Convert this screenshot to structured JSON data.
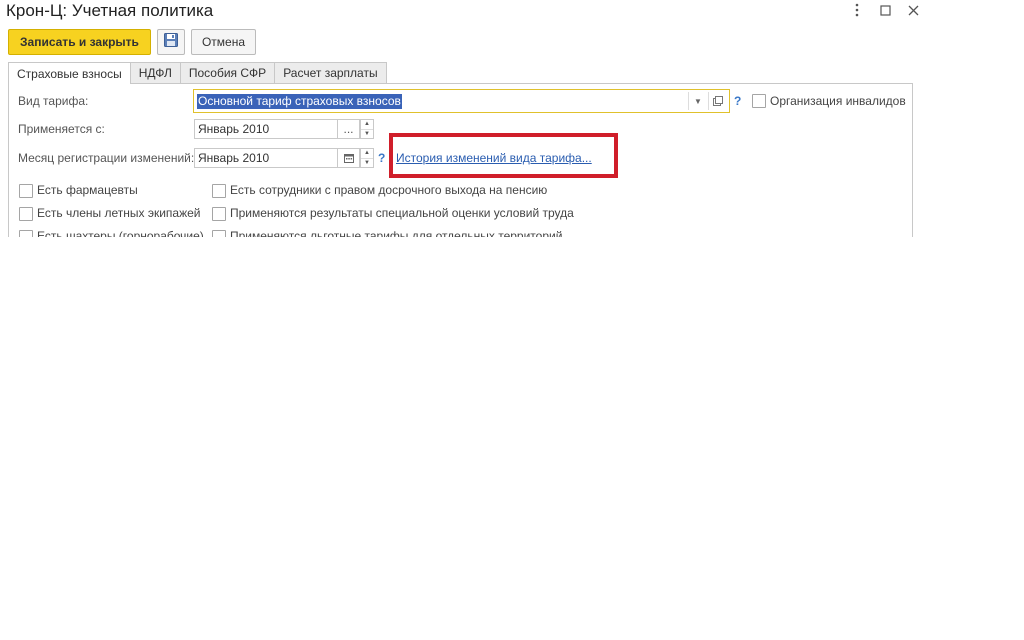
{
  "window": {
    "title": "Крон-Ц: Учетная политика",
    "controls": [
      "more-icon",
      "maximize-icon",
      "close-icon"
    ]
  },
  "toolbar": {
    "save_close_label": "Записать и закрыть",
    "save_icon": "floppy-disk-icon",
    "cancel_label": "Отмена"
  },
  "tabs": [
    {
      "label": "Страховые взносы",
      "active": true
    },
    {
      "label": "НДФЛ",
      "active": false
    },
    {
      "label": "Пособия СФР",
      "active": false
    },
    {
      "label": "Расчет зарплаты",
      "active": false
    }
  ],
  "form": {
    "tariff_label": "Вид тарифа:",
    "tariff_value": "Основной тариф страховых взносов",
    "help_mark": "?",
    "invalid_org_label": "Организация инвалидов",
    "applies_from_label": "Применяется с:",
    "applies_from_value": "Январь 2010",
    "applies_from_picker": "...",
    "reg_month_label": "Месяц регистрации изменений:",
    "reg_month_value": "Январь 2010",
    "history_link": "История изменений вида тарифа..."
  },
  "checkboxes_left": [
    {
      "label": "Есть фармацевты",
      "checked": false
    },
    {
      "label": "Есть члены летных экипажей",
      "checked": false
    },
    {
      "label": "Есть шахтеры (горнорабочие)",
      "checked": false
    }
  ],
  "checkboxes_right": [
    {
      "label": "Есть сотрудники с правом досрочного выхода на пенсию",
      "checked": false
    },
    {
      "label": "Применяются результаты специальной оценки условий труда",
      "checked": false
    },
    {
      "label": "Применяются льготные тарифы для отдельных территорий",
      "checked": false
    }
  ],
  "colors": {
    "primary_button": "#f7d220",
    "selection": "#3a63b8",
    "link": "#2a5db0",
    "highlight_box": "#d01e2a"
  }
}
